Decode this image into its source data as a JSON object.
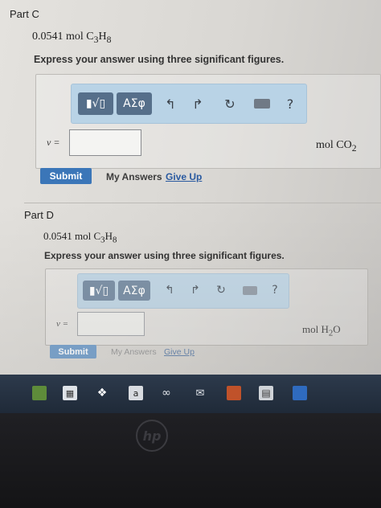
{
  "parts": [
    {
      "title": "Part C",
      "quantity": "0.0541 mol C",
      "q_sub1": "3",
      "q_mid": "H",
      "q_sub2": "8",
      "instruction": "Express your answer using three significant figures.",
      "toolbar": {
        "math_btn": "▮√▯",
        "greek_btn": "ΑΣφ",
        "help": "?"
      },
      "variable": "ν =",
      "unit_main": "mol CO",
      "unit_sub": "2",
      "submit": "Submit",
      "my_answers": "My Answers",
      "give_up": "Give Up"
    },
    {
      "title": "Part D",
      "quantity": "0.0541 mol C",
      "q_sub1": "3",
      "q_mid": "H",
      "q_sub2": "8",
      "instruction": "Express your answer using three significant figures.",
      "toolbar": {
        "math_btn": "▮√▯",
        "greek_btn": "ΑΣφ",
        "help": "?"
      },
      "variable": "ν =",
      "unit_main": "mol H",
      "unit_sub": "2",
      "unit_tail": "O",
      "submit": "Submit",
      "my_answers": "My Answers",
      "give_up": "Give Up"
    }
  ],
  "taskbar": {
    "store_label": "a"
  },
  "colors": {
    "submit": "#3b76b8",
    "give_up_link": "#2a5aa0",
    "toolbar": "#b9d3e6"
  }
}
